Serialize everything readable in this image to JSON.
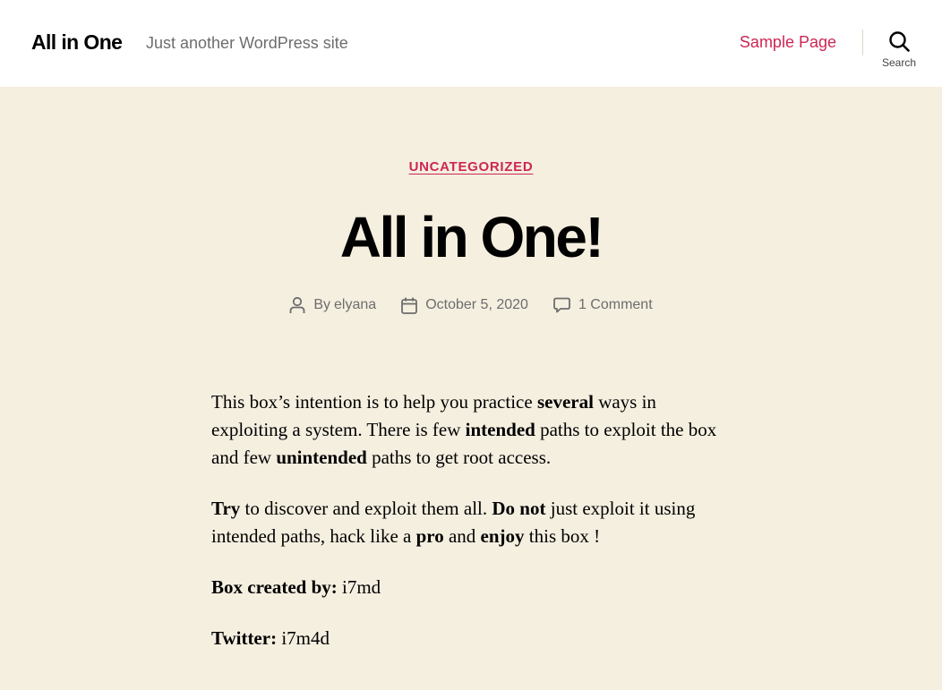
{
  "header": {
    "site_title": "All in One",
    "site_description": "Just another WordPress site",
    "nav": [
      {
        "label": "Sample Page"
      }
    ],
    "search_label": "Search"
  },
  "post": {
    "category": "UNCATEGORIZED",
    "title": "All in One!",
    "meta": {
      "author_prefix": "By",
      "author": "elyana",
      "date": "October 5, 2020",
      "comments": "1 Comment"
    },
    "content": {
      "p1": {
        "t1": "This box’s intention is to help you practice ",
        "b1": "several",
        "t2": " ways in exploiting a system. There is few ",
        "b2": "intended",
        "t3": " paths to exploit the box and few ",
        "b3": "unintended",
        "t4": " paths to get root access."
      },
      "p2": {
        "b1": "Try",
        "t1": " to discover and exploit them all. ",
        "b2": "Do not",
        "t2": " just exploit it using intended paths, hack like a ",
        "b3": "pro",
        "t3": " and ",
        "b4": "enjoy",
        "t4": " this box !"
      },
      "p3": {
        "label": "Box created by:",
        "value": " i7md"
      },
      "p4": {
        "label": "Twitter:",
        "value": " i7m4d"
      }
    }
  },
  "colors": {
    "accent": "#cd2653",
    "background": "#f5efe0",
    "header_bg": "#ffffff",
    "muted_text": "#6d6d6d"
  },
  "icons": [
    "search-icon",
    "user-icon",
    "calendar-icon",
    "comment-icon"
  ]
}
